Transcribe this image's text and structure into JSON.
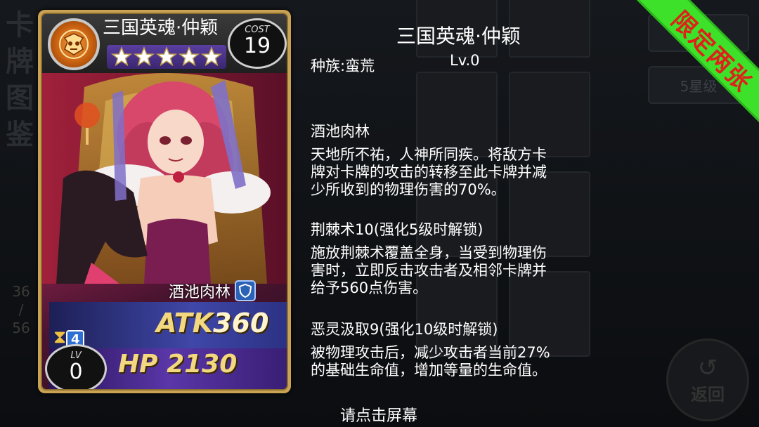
{
  "background": {
    "gallery_title": [
      "卡",
      "牌",
      "图",
      "鉴"
    ],
    "page_current": "36",
    "page_sep": "/",
    "page_total": "56",
    "filter_button": "5星级",
    "return_label": "返回"
  },
  "ribbon": {
    "text": "限定两张",
    "bg_color": "#3ee12a",
    "text_color": "#e0201a"
  },
  "card": {
    "name": "三国英魂·仲颖",
    "star_count": 5,
    "cost_label": "COST",
    "cost_value": "19",
    "skill_tag": "酒池肉林",
    "skill_icon": "shield-icon",
    "sequence_value": "4",
    "atk_label": "ATK",
    "atk_value": "360",
    "hp_label": "HP",
    "hp_value": "2130",
    "lv_label": "LV",
    "lv_value": "0",
    "frame_color": "#caa253"
  },
  "info": {
    "title": "三国英魂·仲颖",
    "race": "种族:蛮荒",
    "level": "Lv.0",
    "skills": [
      {
        "name": "酒池肉林",
        "desc": [
          "天地所不祐，人神所同疾。将敌方卡",
          "牌对卡牌的攻击的转移至此卡牌并减",
          "少所收到的物理伤害的70%。"
        ]
      },
      {
        "name": "荆棘术10(强化5级时解锁)",
        "desc": [
          "施放荆棘术覆盖全身，当受到物理伤",
          "害时，立即反击攻击者及相邻卡牌并",
          "给予560点伤害。"
        ]
      },
      {
        "name": "恶灵汲取9(强化10级时解锁)",
        "desc": [
          "被物理攻击后，减少攻击者当前27%",
          "的基础生命值，增加等量的生命值。"
        ]
      }
    ]
  },
  "tap_hint": "请点击屏幕"
}
